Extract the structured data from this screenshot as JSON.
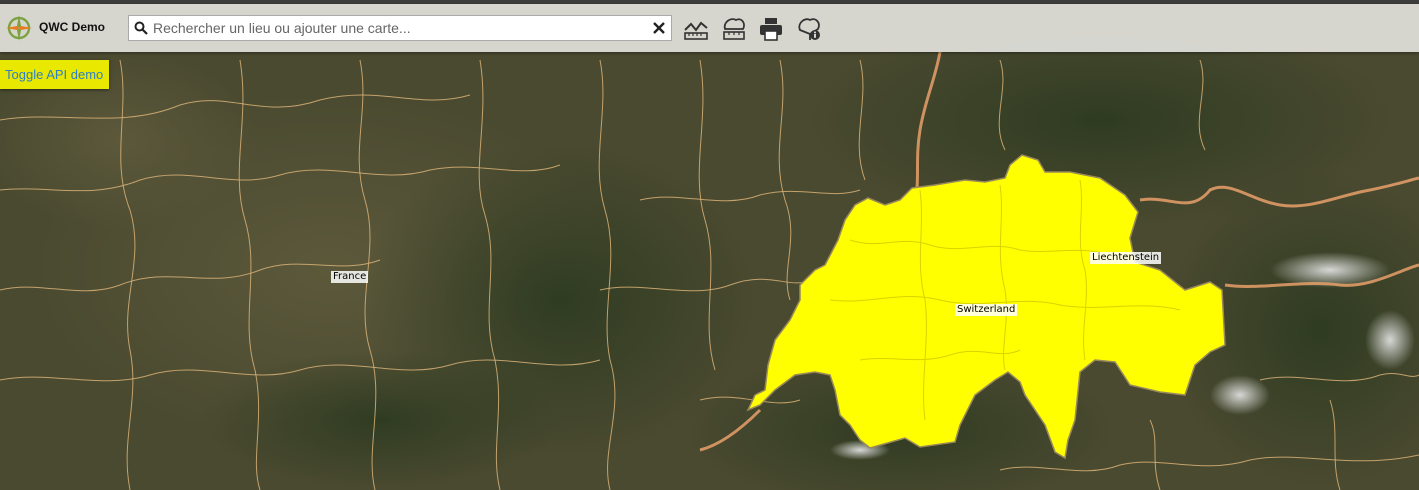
{
  "app": {
    "title": "QWC Demo"
  },
  "search": {
    "placeholder": "Rechercher un lieu ou ajouter une carte..."
  },
  "toolbar": {
    "tools": [
      {
        "icon": "measure-icon"
      },
      {
        "icon": "draw-icon"
      },
      {
        "icon": "print-icon"
      },
      {
        "icon": "info-icon"
      }
    ]
  },
  "api_button": {
    "label": "Toggle API demo"
  },
  "map": {
    "highlight_color": "#ffff00",
    "labels": {
      "france": "France",
      "switzerland": "Switzerland",
      "liechtenstein": "Liechtenstein"
    }
  }
}
